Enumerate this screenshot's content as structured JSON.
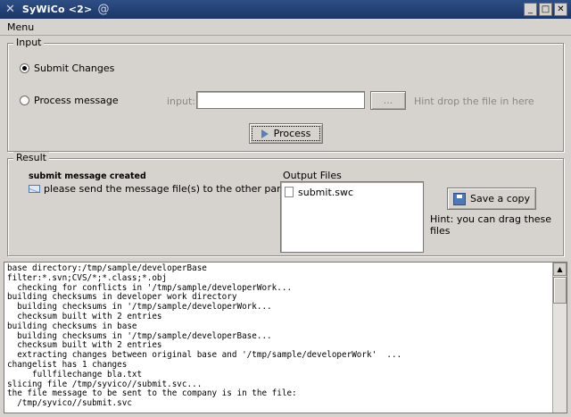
{
  "window": {
    "title": "SyWiCo <2>",
    "controls": {
      "minimize": "_",
      "maximize": "□",
      "close": "✕"
    }
  },
  "menu": {
    "items": [
      "Menu"
    ]
  },
  "input_group": {
    "legend": "Input",
    "submit_label": "Submit Changes",
    "process_message_label": "Process message",
    "input_label": "input:",
    "input_value": "",
    "browse_label": "...",
    "hint": "Hint drop the file in here",
    "process_button": "Process",
    "selected": "submit"
  },
  "result_group": {
    "legend": "Result",
    "status_title": "submit message created",
    "status_text": "please send the message file(s) to the other party",
    "output_files_legend": "Output Files",
    "files": [
      "submit.swc"
    ],
    "save_button": "Save a copy",
    "drag_hint": "Hint: you can drag these files"
  },
  "log": {
    "lines": [
      "base directory:/tmp/sample/developerBase",
      "filter:*.svn;CVS/*;*.class;*.obj",
      "  checking for conflicts in '/tmp/sample/developerWork...",
      "building checksums in developer work directory",
      "  building checksums in '/tmp/sample/developerWork...",
      "  checksum built with 2 entries",
      "building checksums in base",
      "  building checksums in '/tmp/sample/developerBase...",
      "  checksum built with 2 entries",
      "  extracting changes between original base and '/tmp/sample/developerWork'  ...",
      "changelist has 1 changes",
      "     fullfilechange bla.txt",
      "slicing file /tmp/syvico//submit.svc...",
      "the file message to be sent to the company is in the file:",
      "  /tmp/syvico//submit.svc"
    ]
  }
}
